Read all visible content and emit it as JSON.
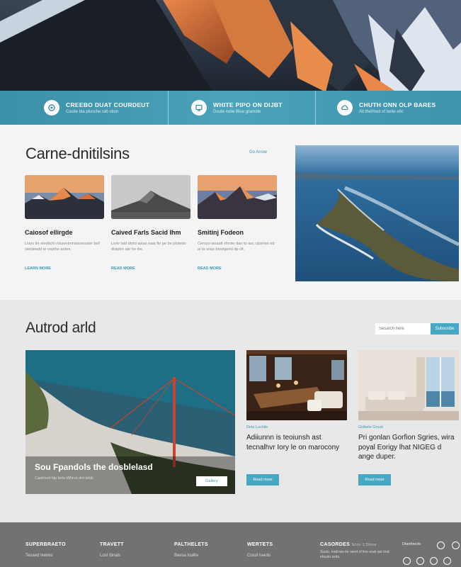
{
  "features": [
    {
      "title": "CREEBO DUAT COURDEUT",
      "sub": "Castle bla plunche rab stion",
      "icon": "circle-badge-icon"
    },
    {
      "title": "WHITE PIPO ON DIJBT",
      "sub": "Doute nolie Blue gramide",
      "icon": "monitor-icon"
    },
    {
      "title": "CHUTH ONN OLP BARES",
      "sub": "Alt thefmed of beite etic",
      "icon": "cloud-icon"
    }
  ],
  "section1": {
    "title": "Carne-dnitilsins",
    "link": "Go Arrow",
    "cards": [
      {
        "title": "Caiosof ellirgde",
        "text": "Lisyu tin eleditchi nlaseebrinsteseaster bell sietdeedd te vepthe ardes.",
        "link": "LEARN MORE"
      },
      {
        "title": "Caived Farls Sacid Ihm",
        "text": "Liotv laid dintd aslas eaat fie pe be plotedo disiptre ate he ihe.",
        "link": "READ MORE"
      },
      {
        "title": "Smitinj Fodeon",
        "text": "Cersyo sioaalt shrote dan to asc cdsmes ed ai ta snas bioolgeed dp clt.",
        "link": "READ MORE"
      }
    ]
  },
  "section2": {
    "title": "Autrod arld",
    "search_placeholder": "Sesarch here",
    "search_button": "Subscribe",
    "big": {
      "title": "Sou Fpandols the dosblelasd",
      "sub": "Caelrtoot hip lerlo-Whrcn dnt lelds",
      "button": "Gallery"
    },
    "posts": [
      {
        "tag": "Dela Luchile",
        "title": "Adiiunnn is teoiunsh ast tecnalhvr Iory le on marocony",
        "button": "Read more"
      },
      {
        "tag": "Gidkele Goust",
        "title": "Pri gonlan Gorfion Sgries, wira poyal Eorigy lhat NIGEG d ange duper.",
        "button": "Read more"
      }
    ]
  },
  "footer": {
    "columns": [
      {
        "head": "SUPERBRAETO",
        "items": [
          "Tesaed Iewres"
        ]
      },
      {
        "head": "TRAVETT",
        "items": [
          "Lost Ibnals"
        ]
      },
      {
        "head": "PALTHELETS",
        "items": [
          "Baxsa Ioalbs"
        ]
      },
      {
        "head": "WERTETS",
        "items": [
          "Cosul Ioaols"
        ]
      }
    ],
    "contact": {
      "head": "CASORDES",
      "sub": "Scos 1:Dtore",
      "note": "Susto, mrdrnse ite oeed of line ecwt aoi rmd ehusto zeds."
    },
    "brand": "Dlanthecte",
    "social_icons": [
      "instagram-icon",
      "twitter-icon",
      "facebook-icon",
      "pinterest-icon",
      "youtube-icon"
    ]
  },
  "colors": {
    "accent": "#46a8c2",
    "feature_bar": "#4aa3bb",
    "footer": "#727272"
  }
}
